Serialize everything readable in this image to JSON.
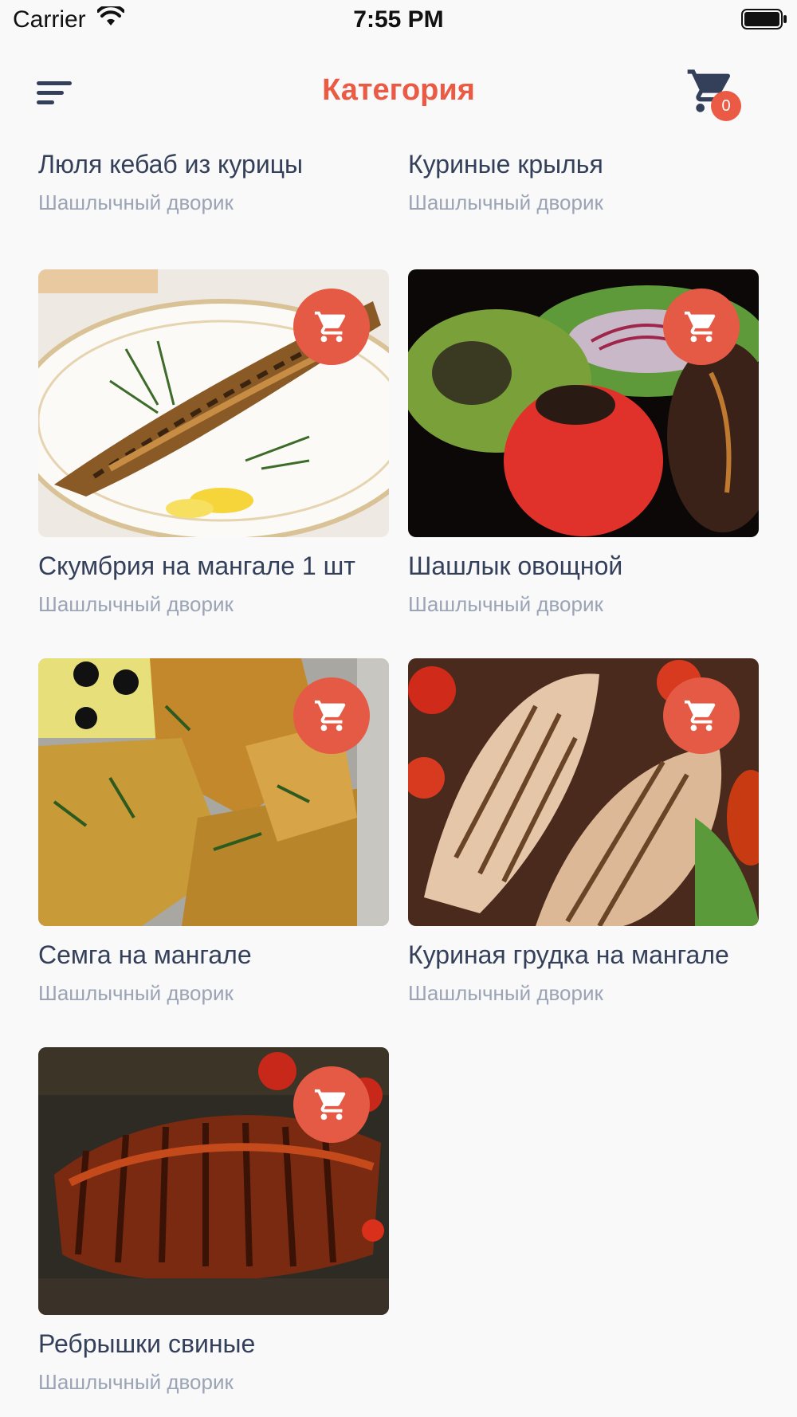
{
  "status_bar": {
    "carrier": "Carrier",
    "time": "7:55 PM"
  },
  "header": {
    "title": "Категория",
    "cart_count": "0"
  },
  "colors": {
    "accent": "#ea5a44",
    "text": "#34405a",
    "subtext": "#9aa4b5"
  },
  "products": [
    {
      "title": "Люля кебаб из курицы",
      "vendor": "Шашлычный дворик"
    },
    {
      "title": "Куриные крылья",
      "vendor": "Шашлычный дворик"
    },
    {
      "title": "Скумбрия на мангале 1 шт",
      "vendor": "Шашлычный дворик",
      "image": "grilled-mackerel-photo"
    },
    {
      "title": "Шашлык овощной",
      "vendor": "Шашлычный дворик",
      "image": "grilled-vegetables-photo"
    },
    {
      "title": "Семга на мангале",
      "vendor": "Шашлычный дворик",
      "image": "grilled-salmon-photo"
    },
    {
      "title": "Куриная грудка на мангале",
      "vendor": "Шашлычный дворик",
      "image": "grilled-chicken-breast-photo"
    },
    {
      "title": "Ребрышки свиные",
      "vendor": "Шашлычный дворик",
      "image": "pork-ribs-photo"
    }
  ]
}
